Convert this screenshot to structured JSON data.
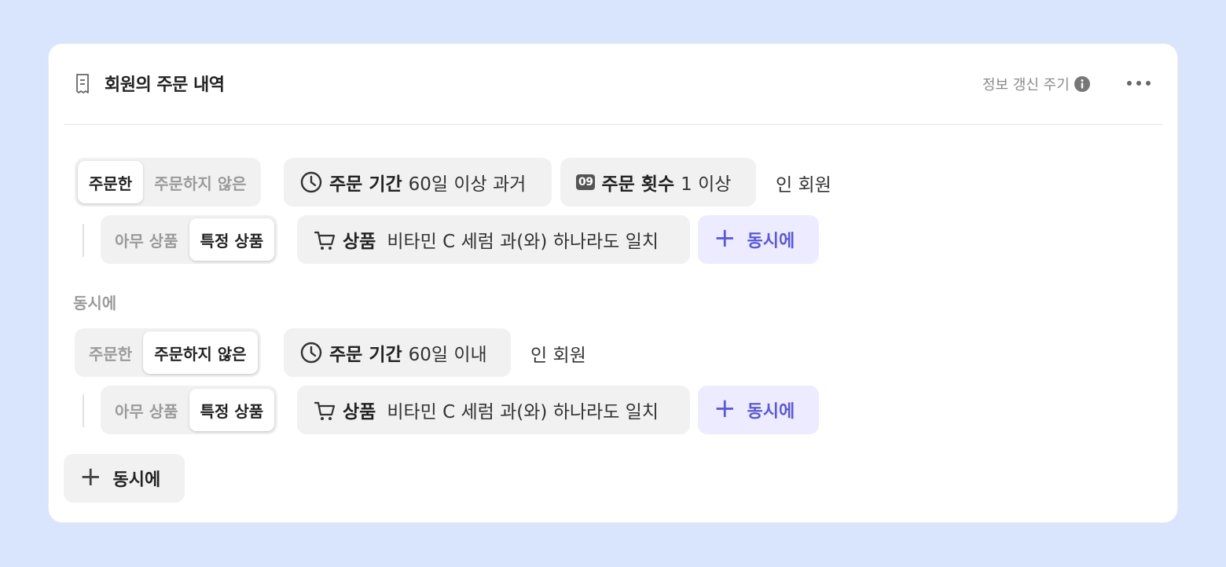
{
  "header": {
    "title": "회원의 주문 내역",
    "refresh_label": "정보 갱신 주기"
  },
  "group1": {
    "order_toggle": [
      "주문한",
      "주문하지 않은"
    ],
    "order_selected": "주문한",
    "period_label": "주문 기간",
    "period_value": "60일 이상 과거",
    "count_badge": "09",
    "count_label": "주문 횟수",
    "count_value": "1 이상",
    "suffix": "인 회원",
    "product_toggle": [
      "아무 상품",
      "특정 상품"
    ],
    "product_selected": "특정 상품",
    "product_label": "상품",
    "product_value": "비타민 C 세럼 과(와) 하나라도 일치",
    "add_simul": "동시에"
  },
  "separator": "동시에",
  "group2": {
    "order_toggle": [
      "주문한",
      "주문하지 않은"
    ],
    "order_selected": "주문하지 않은",
    "period_label": "주문 기간",
    "period_value": "60일 이내",
    "suffix": "인 회원",
    "product_toggle": [
      "아무 상품",
      "특정 상품"
    ],
    "product_selected": "특정 상품",
    "product_label": "상품",
    "product_value": "비타민 C 세럼 과(와) 하나라도 일치",
    "add_simul": "동시에"
  },
  "footer": {
    "add_simul": "동시에"
  },
  "icons": [
    "receipt-icon",
    "info-icon",
    "more-icon",
    "clock-icon",
    "calendar-09-icon",
    "cart-icon",
    "plus-icon"
  ],
  "colors": {
    "background": "#d9e5fc",
    "accent": "#5c59d4",
    "accent_bg": "#ecebff",
    "chip": "#f1f1f2"
  }
}
